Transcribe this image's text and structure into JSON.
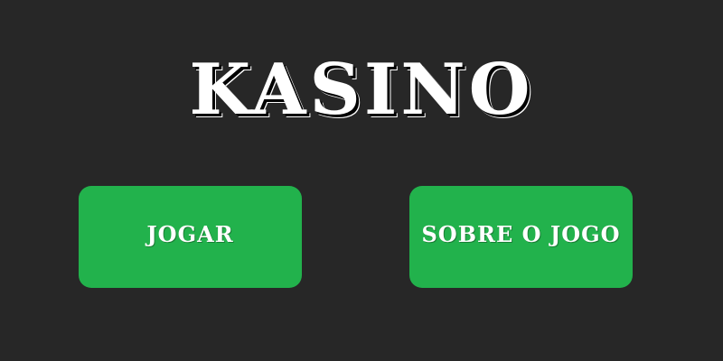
{
  "screen": {
    "title": "KASINO"
  },
  "menu": {
    "play_label": "JOGAR",
    "about_label": "SOBRE O JOGO"
  },
  "colors": {
    "background": "#272727",
    "button": "#22b24c",
    "text": "#ffffff"
  }
}
